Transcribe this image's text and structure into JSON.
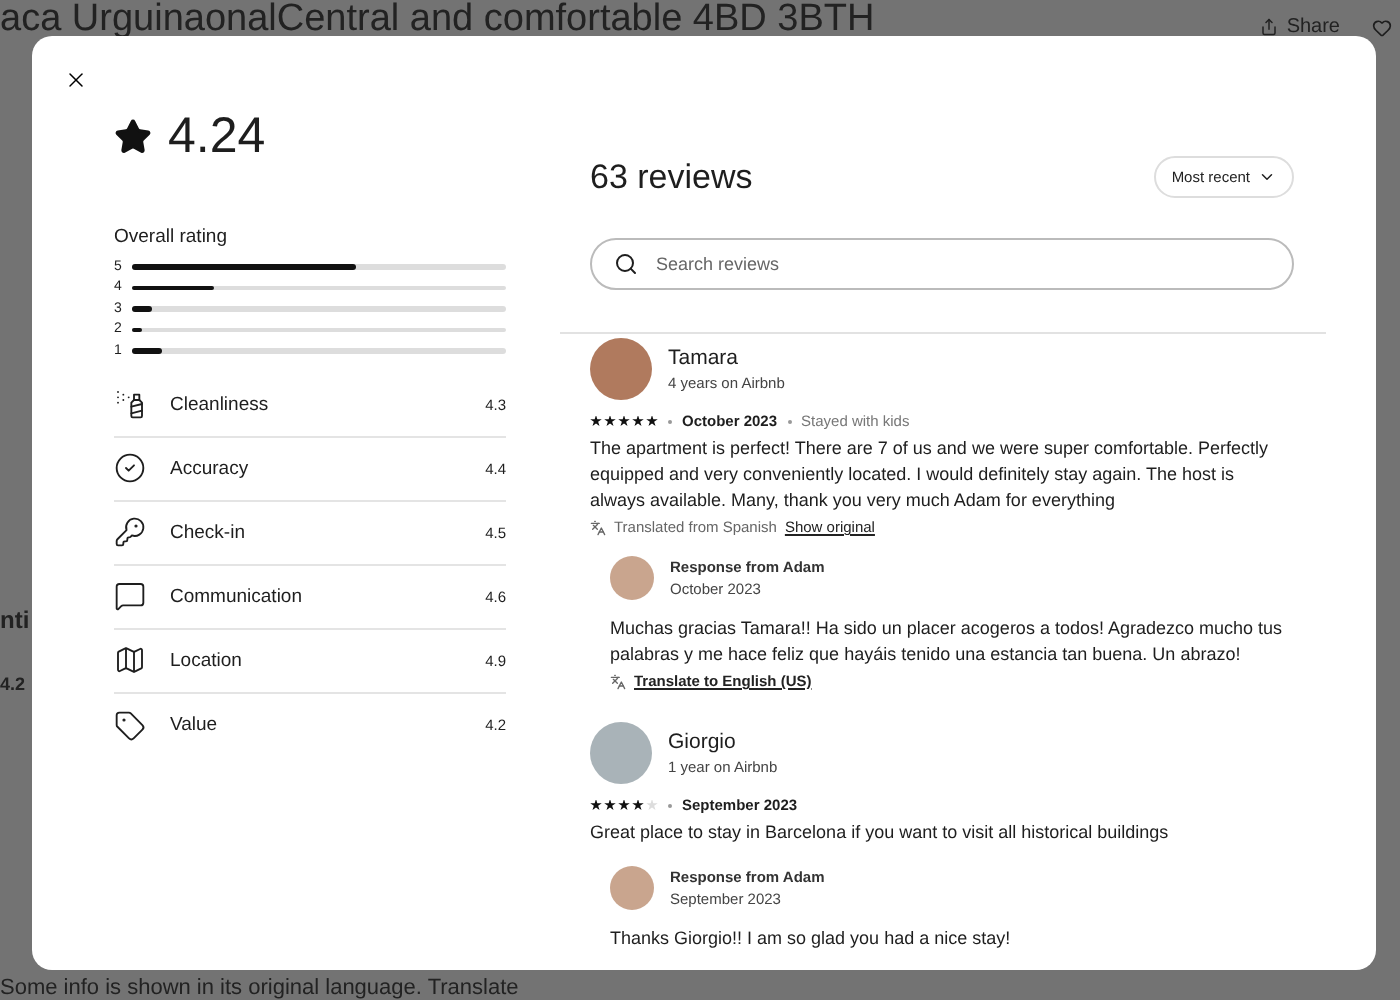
{
  "background": {
    "title": "aca UrguinaonalCentral and comfortable 4BD 3BTH",
    "share": "Share",
    "fragments": [
      "nti",
      "4.2"
    ],
    "footer_note": "Some info is shown in its original language. Translate"
  },
  "modal": {
    "rating": "4.24",
    "overall_label": "Overall rating",
    "distribution": [
      {
        "label": "5",
        "level": 0.6
      },
      {
        "label": "4",
        "level": 0.22
      },
      {
        "label": "3",
        "level": 0.055
      },
      {
        "label": "2",
        "level": 0.025
      },
      {
        "label": "1",
        "level": 0.08
      }
    ],
    "categories": [
      {
        "name": "Cleanliness",
        "score": "4.3"
      },
      {
        "name": "Accuracy",
        "score": "4.4"
      },
      {
        "name": "Check-in",
        "score": "4.5"
      },
      {
        "name": "Communication",
        "score": "4.6"
      },
      {
        "name": "Location",
        "score": "4.9"
      },
      {
        "name": "Value",
        "score": "4.2"
      }
    ],
    "reviews_title": "63 reviews",
    "sort": "Most recent",
    "search": {
      "placeholder": "Search reviews"
    },
    "reviews": [
      {
        "name": "Tamara",
        "tenure": "4 years on Airbnb",
        "stars": 5,
        "date": "October 2023",
        "trip": "Stayed with kids",
        "text": "The apartment is perfect! There are 7 of us and we were super comfortable. Perfectly equipped and very conveniently located. I would definitely stay again. The host is always available. Many, thank you very much Adam for everything",
        "translation_note": "Translated from Spanish",
        "translation_link": "Show original",
        "response": {
          "title": "Response from Adam",
          "date": "October 2023",
          "text": "Muchas gracias Tamara!! Ha sido un placer acogeros a todos! Agradezco mucho tus palabras y me hace feliz que hayáis tenido una estancia tan buena. Un abrazo!",
          "translate_link": "Translate to English (US)"
        }
      },
      {
        "name": "Giorgio",
        "tenure": "1 year on Airbnb",
        "stars": 4,
        "date": "September 2023",
        "text": "Great place to stay in Barcelona if you want to visit all historical buildings",
        "response": {
          "title": "Response from Adam",
          "date": "September 2023",
          "text": "Thanks Giorgio!! I am so glad you had a nice stay!"
        }
      }
    ]
  }
}
